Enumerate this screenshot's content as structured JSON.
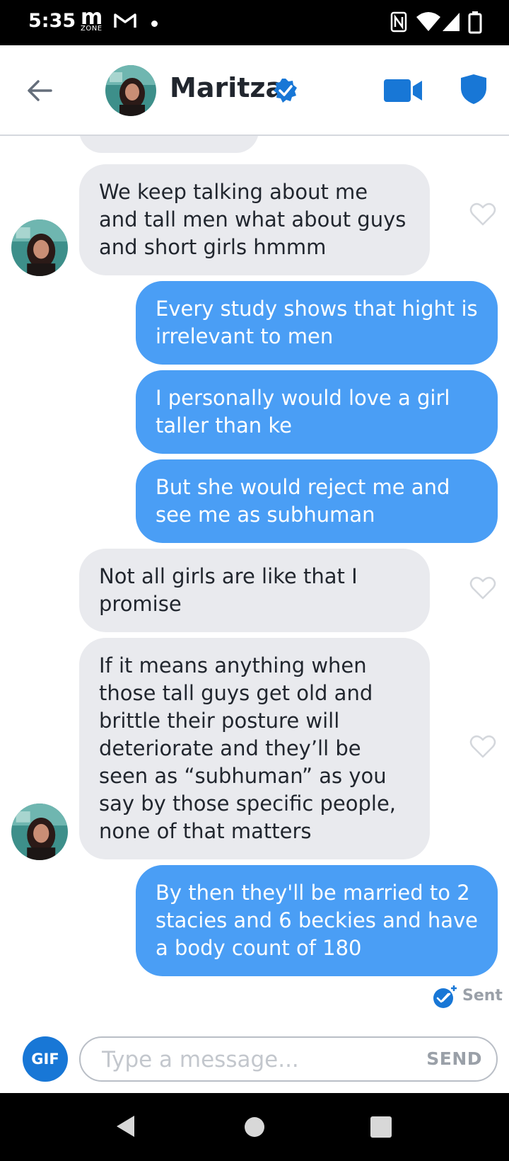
{
  "status_bar": {
    "time": "5:35",
    "zone_logo": "m",
    "zone_label": "ZONE",
    "icons": [
      "mail-icon",
      "dot-icon",
      "nfc-icon",
      "wifi-icon",
      "signal-icon",
      "battery-icon"
    ]
  },
  "header": {
    "name": "Maritza",
    "icons": [
      "back-arrow-icon",
      "verified-badge-icon",
      "video-call-icon",
      "safety-shield-icon"
    ],
    "accent_color": "#1877d6"
  },
  "messages": [
    {
      "side": "in",
      "text": "",
      "partial": true
    },
    {
      "side": "in",
      "text": "We keep talking about me and tall men what about guys and short girls hmmm"
    },
    {
      "side": "out",
      "text": "Every study shows that hight is irrelevant to men"
    },
    {
      "side": "out",
      "text": "I personally would love a girl taller than ke"
    },
    {
      "side": "out",
      "text": "But she would reject me and see me as subhuman"
    },
    {
      "side": "in",
      "text": "Not all girls are like that I promise"
    },
    {
      "side": "in",
      "text": "If it means anything when those tall guys get old and brittle their posture will deteriorate and they’ll be seen as “subhuman” as you say by those specific people, none of that matters"
    },
    {
      "side": "out",
      "text": "By then they'll be married to 2 stacies and 6 beckies and have a body count of 180"
    }
  ],
  "sent_status": "Sent",
  "composer": {
    "gif_label": "GIF",
    "placeholder": "Type a message...",
    "value": "",
    "send_label": "SEND"
  },
  "colors": {
    "outgoing_bubble": "#4a9ef5",
    "incoming_bubble": "#e9eaee",
    "brand_blue": "#1877d6"
  }
}
